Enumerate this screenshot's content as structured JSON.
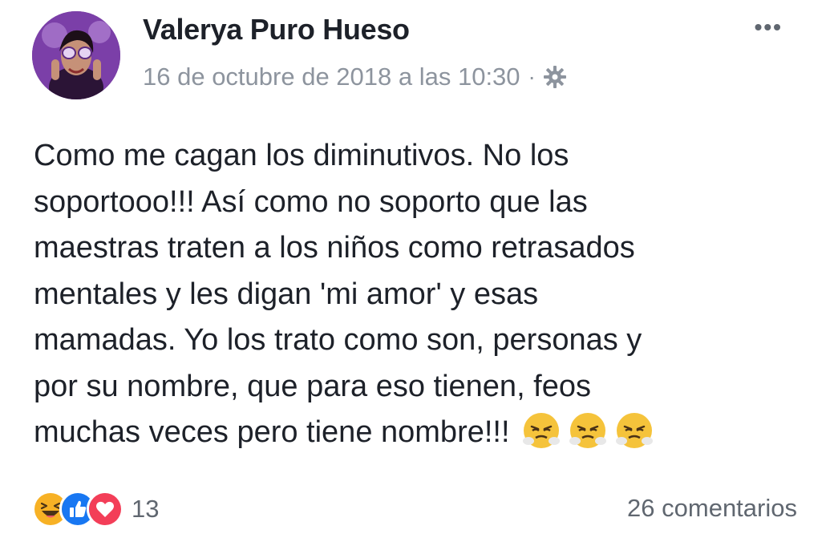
{
  "post": {
    "author": "Valerya Puro Hueso",
    "timestamp": "16 de octubre de 2018 a las 10:30",
    "separator": "·",
    "privacy_icon": "gear-icon",
    "more_label": "•••",
    "text_lines": [
      "Como me cagan los diminutivos. No los",
      "soportooo!!! Así como no soporto que las",
      "maestras traten a los niños como retrasados",
      "mentales y les digan 'mi amor' y esas",
      "mamadas. Yo los trato como son, personas y",
      "por su nombre, que para eso tienen, feos",
      "muchas veces pero tiene nombre!!!"
    ],
    "trailing_emojis": [
      "angry-steam-emoji",
      "angry-steam-emoji",
      "angry-steam-emoji"
    ]
  },
  "footer": {
    "reaction_icons": [
      "haha-icon",
      "like-icon",
      "love-icon"
    ],
    "reaction_count": "13",
    "comments_label": "26 comentarios"
  },
  "colors": {
    "text": "#1d2129",
    "meta": "#8d949e",
    "like": "#1877f2",
    "love": "#f33e58",
    "haha": "#f7b125"
  }
}
